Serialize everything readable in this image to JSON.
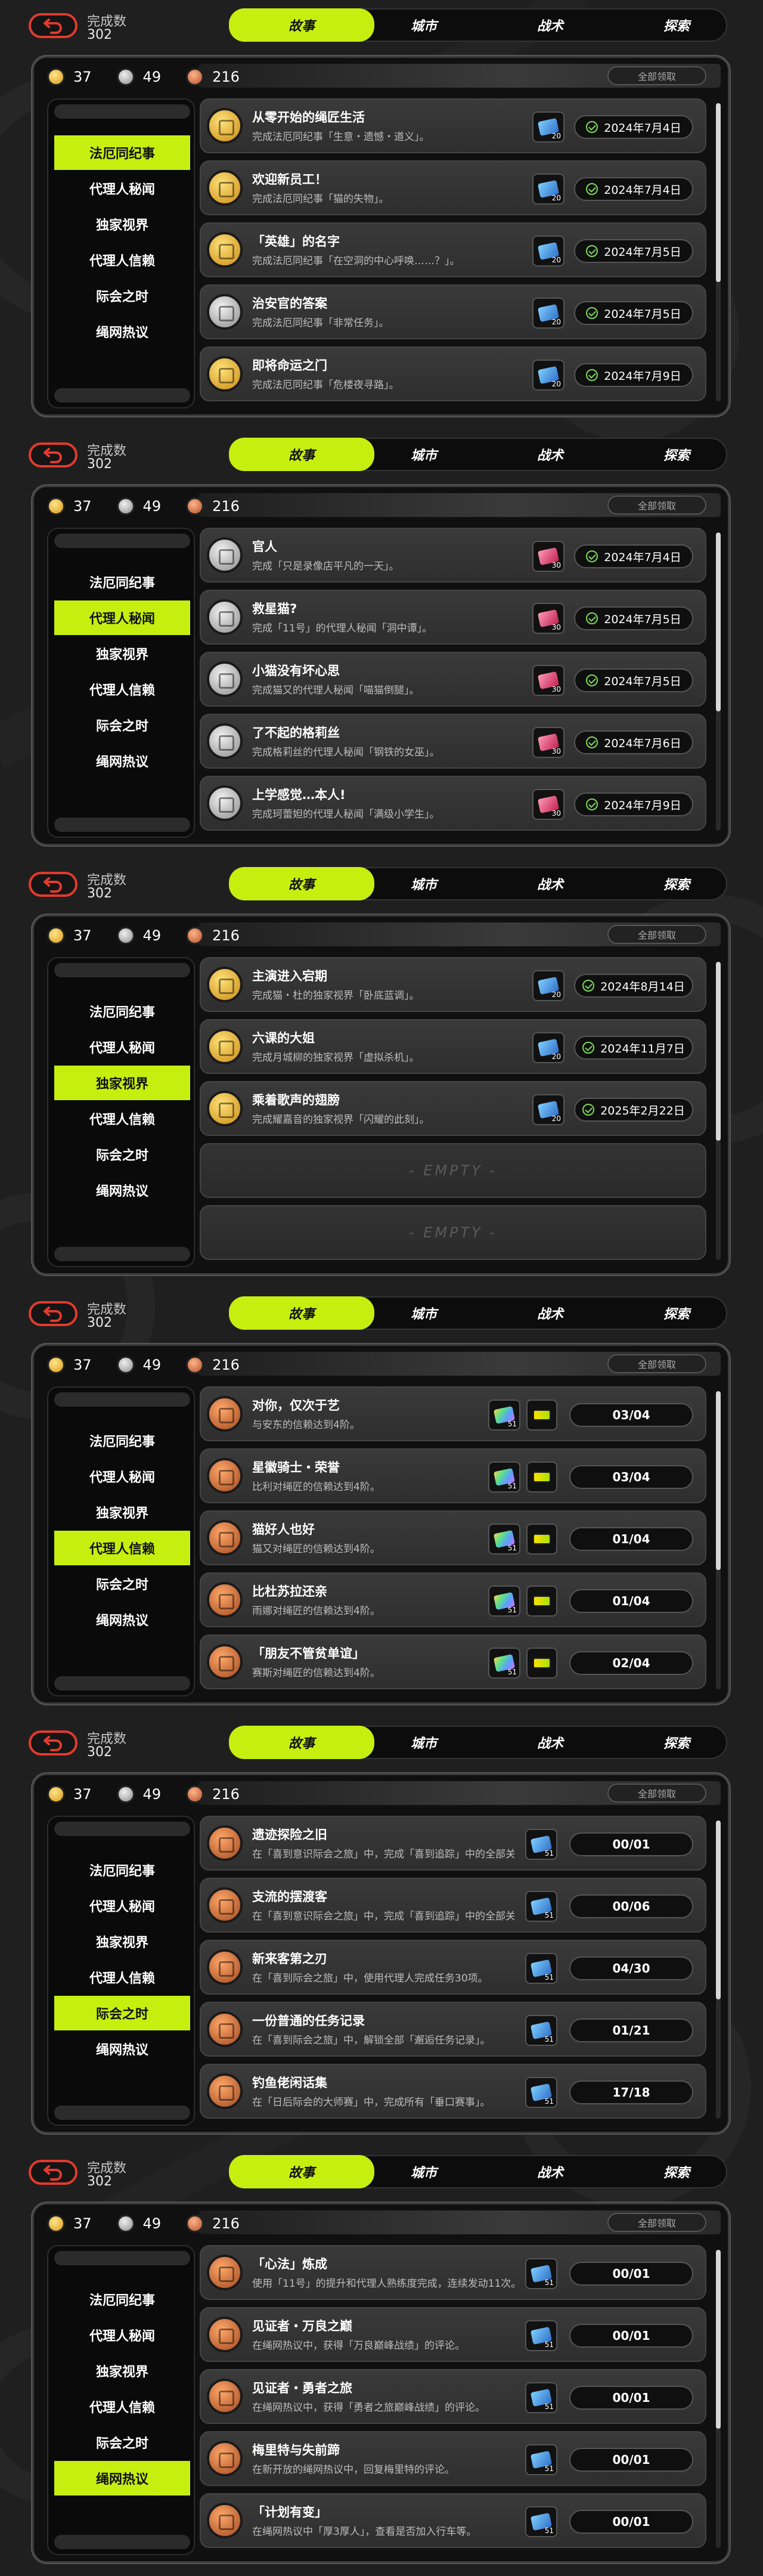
{
  "header": {
    "complete_label": "完成数",
    "complete_count": "302",
    "tabs": [
      "故事",
      "城市",
      "战术",
      "探索"
    ]
  },
  "currency": [
    "37",
    "49",
    "216"
  ],
  "claim_all": "全部领取",
  "sidebar_labels": [
    "法厄同纪事",
    "代理人秘闻",
    "独家视界",
    "代理人信赖",
    "际会之时",
    "绳网热议"
  ],
  "colors": {
    "accent": "#c6ef10",
    "back": "#e23a2e",
    "check": "#7cd95a"
  },
  "panels": [
    {
      "active_tab": 0,
      "active_side": 0,
      "rows": [
        {
          "medal": "gold",
          "title": "从零开始的绳匠生活",
          "desc": "完成法厄同纪事「生意・遗憾・道义」。",
          "reward": "20",
          "status": "2024年7月4日"
        },
        {
          "medal": "gold",
          "title": "欢迎新员工！",
          "desc": "完成法厄同纪事「猫的失物」。",
          "reward": "20",
          "status": "2024年7月4日"
        },
        {
          "medal": "gold",
          "title": "「英雄」的名字",
          "desc": "完成法厄同纪事「在空洞的中心呼唤……？」。",
          "reward": "20",
          "status": "2024年7月5日"
        },
        {
          "medal": "silver",
          "title": "治安官的答案",
          "desc": "完成法厄同纪事「非常任务」。",
          "reward": "20",
          "status": "2024年7月5日"
        },
        {
          "medal": "gold",
          "title": "即将命运之门",
          "desc": "完成法厄同纪事「危楼夜寻路」。",
          "reward": "20",
          "status": "2024年7月9日"
        }
      ]
    },
    {
      "active_tab": 0,
      "active_side": 1,
      "rows": [
        {
          "medal": "silver",
          "title": "官人",
          "desc": "完成「只是录像店平凡的一天」。",
          "reward": "30",
          "pink": true,
          "status": "2024年7月4日"
        },
        {
          "medal": "silver",
          "title": "救星猫?",
          "desc": "完成「11号」的代理人秘闻「洞中谭」。",
          "reward": "30",
          "pink": true,
          "status": "2024年7月5日"
        },
        {
          "medal": "silver",
          "title": "小猫没有坏心思",
          "desc": "完成猫又的代理人秘闻「喵猫倒腿」。",
          "reward": "30",
          "pink": true,
          "status": "2024年7月5日"
        },
        {
          "medal": "silver",
          "title": "了不起的格莉丝",
          "desc": "完成格莉丝的代理人秘闻「钢铁的女巫」。",
          "reward": "30",
          "pink": true,
          "status": "2024年7月6日"
        },
        {
          "medal": "silver",
          "title": "上学感觉…本人!",
          "desc": "完成珂蕾妲的代理人秘闻「满级小学生」。",
          "reward": "30",
          "pink": true,
          "status": "2024年7月9日"
        }
      ]
    },
    {
      "active_tab": 0,
      "active_side": 2,
      "rows": [
        {
          "medal": "gold",
          "title": "主演进入宕期",
          "desc": "完成猫・杜的独家视界「卧底蓝调」。",
          "reward": "20",
          "status": "2024年8月14日"
        },
        {
          "medal": "gold",
          "title": "六课的大姐",
          "desc": "完成月城柳的独家视界「虚拟杀机」。",
          "reward": "20",
          "status": "2024年11月7日"
        },
        {
          "medal": "gold",
          "title": "乘着歌声的翅膀",
          "desc": "完成耀嘉音的独家视界「闪耀的此刻」。",
          "reward": "20",
          "status": "2025年2月22日"
        },
        {
          "empty": true,
          "label": "- EMPTY -"
        },
        {
          "empty": true,
          "label": "- EMPTY -"
        }
      ]
    },
    {
      "active_tab": 0,
      "active_side": 3,
      "rows": [
        {
          "medal": "bronze",
          "title": "对你，仅次于艺",
          "desc": "与安东的信赖达到4阶。",
          "reward": "51",
          "rainbow": true,
          "gem": true,
          "progress": "03/04"
        },
        {
          "medal": "bronze",
          "title": "星徽骑士・荣誉",
          "desc": "比利对绳匠的信赖达到4阶。",
          "reward": "51",
          "rainbow": true,
          "gem": true,
          "progress": "03/04"
        },
        {
          "medal": "bronze",
          "title": "猫好人也好",
          "desc": "猫又对绳匠的信赖达到4阶。",
          "reward": "51",
          "rainbow": true,
          "gem": true,
          "progress": "01/04"
        },
        {
          "medal": "bronze",
          "title": "比杜苏拉还亲",
          "desc": "雨娜对绳匠的信赖达到4阶。",
          "reward": "51",
          "rainbow": true,
          "gem": true,
          "progress": "01/04"
        },
        {
          "medal": "bronze",
          "title": "「朋友不管贫单谊」",
          "desc": "赛斯对绳匠的信赖达到4阶。",
          "reward": "51",
          "rainbow": true,
          "gem": true,
          "progress": "02/04"
        }
      ]
    },
    {
      "active_tab": 0,
      "active_side": 4,
      "rows": [
        {
          "medal": "bronze",
          "title": "遗迹探险之旧",
          "desc": "在「喜到意识际会之旅」中，完成「喜到追踪」中的全部关卡。",
          "reward": "51",
          "progress": "00/01"
        },
        {
          "medal": "bronze",
          "title": "支流的摆渡客",
          "desc": "在「喜到意识际会之旅」中，完成「喜到追踪」中的全部关卡。",
          "reward": "51",
          "progress": "00/06"
        },
        {
          "medal": "bronze",
          "title": "新来客第之刃",
          "desc": "在「喜到际会之旅」中，使用代理人完成任务30项。",
          "reward": "51",
          "progress": "04/30"
        },
        {
          "medal": "bronze",
          "title": "一份普通的任务记录",
          "desc": "在「喜到际会之旅」中，解锁全部「邂逅任务记录」。",
          "reward": "51",
          "progress": "01/21"
        },
        {
          "medal": "bronze",
          "title": "钓鱼佬闲话集",
          "desc": "在「日后际会的大师赛」中，完成所有「垂口赛事」。",
          "reward": "51",
          "progress": "17/18"
        }
      ]
    },
    {
      "active_tab": 0,
      "active_side": 5,
      "rows": [
        {
          "medal": "bronze",
          "title": "「心法」炼成",
          "desc": "使用「11号」的提升和代理人熟练度完成，连续发动11次。",
          "reward": "51",
          "progress": "00/01"
        },
        {
          "medal": "bronze",
          "title": "见证者・万良之巅",
          "desc": "在绳网热议中，获得「万良巅峰战绩」的评论。",
          "reward": "51",
          "progress": "00/01"
        },
        {
          "medal": "bronze",
          "title": "见证者・勇者之旅",
          "desc": "在绳网热议中，获得「勇者之旅巅峰战绩」的评论。",
          "reward": "51",
          "progress": "00/01"
        },
        {
          "medal": "bronze",
          "title": "梅里特与失前蹄",
          "desc": "在新开放的绳网热议中，回复梅里特的评论。",
          "reward": "51",
          "progress": "00/01"
        },
        {
          "medal": "bronze",
          "title": "「计划有变」",
          "desc": "在绳网热议中「厚3厚人」，查看是否加入行车等。",
          "reward": "51",
          "progress": "00/01"
        }
      ]
    }
  ]
}
